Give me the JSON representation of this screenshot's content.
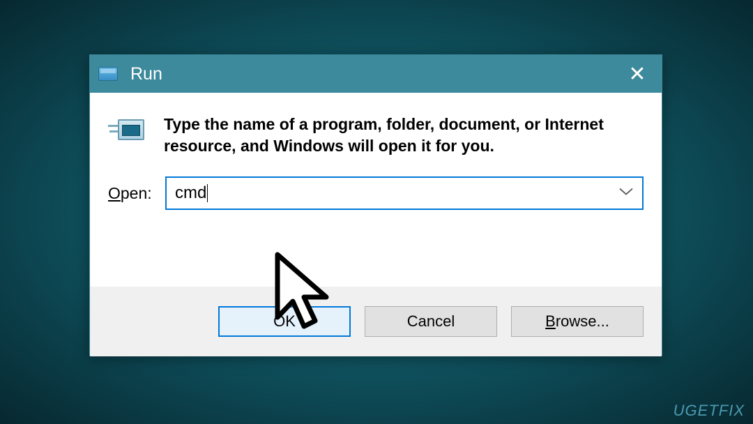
{
  "dialog": {
    "title": "Run",
    "instruction_line1": "Type the name of a program, folder, document, or Internet",
    "instruction_line2": "resource, and Windows will open it for you.",
    "open_label_pre": "O",
    "open_label_post": "pen:",
    "input_value": "cmd",
    "buttons": {
      "ok": "OK",
      "cancel": "Cancel",
      "browse_pre": "B",
      "browse_post": "rowse..."
    }
  },
  "watermark": "UGETFIX"
}
